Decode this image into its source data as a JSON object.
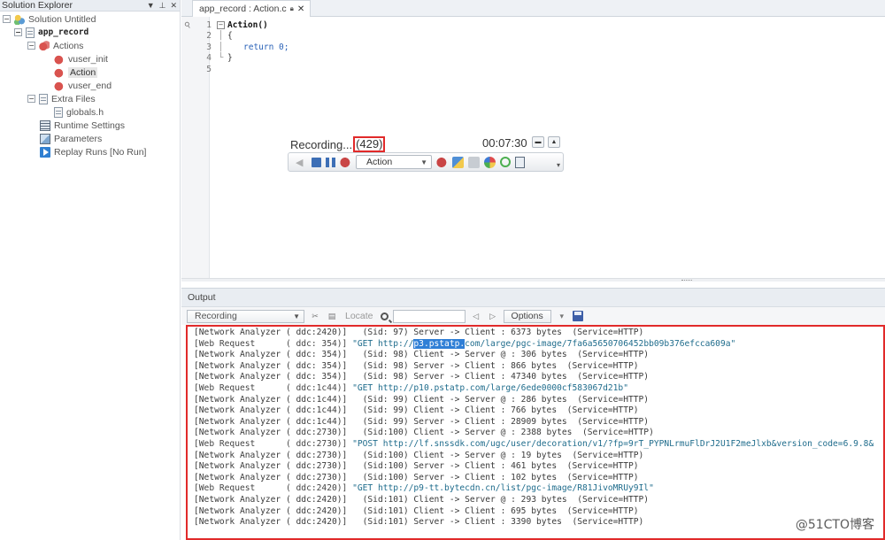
{
  "solution_explorer": {
    "title": "Solution Explorer",
    "icons": [
      "chevron-down-icon",
      "pin-icon",
      "close-icon"
    ],
    "items": [
      {
        "label": "Solution Untitled",
        "icon": "solution-icon"
      },
      {
        "label": "app_record",
        "icon": "script-icon"
      },
      {
        "label": "Actions",
        "icon": "actions-icon"
      },
      {
        "label": "vuser_init",
        "icon": "action-icon"
      },
      {
        "label": "Action",
        "icon": "action-icon"
      },
      {
        "label": "vuser_end",
        "icon": "action-icon"
      },
      {
        "label": "Extra Files",
        "icon": "folder-icon"
      },
      {
        "label": "globals.h",
        "icon": "file-icon"
      },
      {
        "label": "Runtime Settings",
        "icon": "settings-icon"
      },
      {
        "label": "Parameters",
        "icon": "parameters-icon"
      },
      {
        "label": "Replay Runs [No Run]",
        "icon": "replay-icon"
      }
    ]
  },
  "editor": {
    "tab_label": "app_record : Action.c",
    "code_lines": [
      {
        "num": "1",
        "text": "Action()"
      },
      {
        "num": "2",
        "text": "{"
      },
      {
        "num": "3",
        "text": "return 0;"
      },
      {
        "num": "4",
        "text": "}"
      },
      {
        "num": "5",
        "text": ""
      }
    ]
  },
  "recording_toolbar": {
    "label": "Recording...",
    "count": "(429)",
    "timer": "00:07:30",
    "action_select": "Action"
  },
  "output": {
    "title": "Output",
    "source_select": "Recording",
    "locate_label": "Locate",
    "options_label": "Options",
    "log_lines": [
      {
        "src": "[Network Analyzer",
        "ddc": "( ddc:2420)]",
        "msg": "(Sid: 97) Server -> Client : 6373 bytes  (Service=HTTP)"
      },
      {
        "src": "[Web Request     ",
        "ddc": "( ddc: 354)]",
        "msg_pre": "\"GET http://",
        "msg_hl": "p3.pstatp.",
        "msg_post": "com/large/pgc-image/7fa6a5650706452bb09b376efcca609a\""
      },
      {
        "src": "[Network Analyzer",
        "ddc": "( ddc: 354)]",
        "msg": "(Sid: 98) Client -> Server @ : 306 bytes  (Service=HTTP)"
      },
      {
        "src": "[Network Analyzer",
        "ddc": "( ddc: 354)]",
        "msg": "(Sid: 98) Server -> Client : 866 bytes  (Service=HTTP)"
      },
      {
        "src": "[Network Analyzer",
        "ddc": "( ddc: 354)]",
        "msg": "(Sid: 98) Server -> Client : 47340 bytes  (Service=HTTP)"
      },
      {
        "src": "[Web Request     ",
        "ddc": "( ddc:1c44)]",
        "msg_pre": "\"GET http://p10.pstatp.com/large/6ede0000cf583067d21b\""
      },
      {
        "src": "[Network Analyzer",
        "ddc": "( ddc:1c44)]",
        "msg": "(Sid: 99) Client -> Server @ : 286 bytes  (Service=HTTP)"
      },
      {
        "src": "[Network Analyzer",
        "ddc": "( ddc:1c44)]",
        "msg": "(Sid: 99) Client -> Client : 766 bytes  (Service=HTTP)"
      },
      {
        "src": "[Network Analyzer",
        "ddc": "( ddc:1c44)]",
        "msg": "(Sid: 99) Server -> Client : 28909 bytes  (Service=HTTP)"
      },
      {
        "src": "[Network Analyzer",
        "ddc": "( ddc:2730)]",
        "msg": "(Sid:100) Client -> Server @ : 2388 bytes  (Service=HTTP)"
      },
      {
        "src": "[Web Request     ",
        "ddc": "( ddc:2730)]",
        "msg_pre": "\"POST http://lf.snssdk.com/ugc/user/decoration/v1/?fp=9rT_PYPNLrmuFlDrJ2U1F2meJlxb&version_code=6.9.8&"
      },
      {
        "src": "[Network Analyzer",
        "ddc": "( ddc:2730)]",
        "msg": "(Sid:100) Client -> Server @ : 19 bytes  (Service=HTTP)"
      },
      {
        "src": "[Network Analyzer",
        "ddc": "( ddc:2730)]",
        "msg": "(Sid:100) Server -> Client : 461 bytes  (Service=HTTP)"
      },
      {
        "src": "[Network Analyzer",
        "ddc": "( ddc:2730)]",
        "msg": "(Sid:100) Server -> Client : 102 bytes  (Service=HTTP)"
      },
      {
        "src": "[Web Request     ",
        "ddc": "( ddc:2420)]",
        "msg_pre": "\"GET http://p9-tt.bytecdn.cn/list/pgc-image/R81JivoMRUy9Il\""
      },
      {
        "src": "[Network Analyzer",
        "ddc": "( ddc:2420)]",
        "msg": "(Sid:101) Client -> Server @ : 293 bytes  (Service=HTTP)"
      },
      {
        "src": "[Network Analyzer",
        "ddc": "( ddc:2420)]",
        "msg": "(Sid:101) Client -> Client : 695 bytes  (Service=HTTP)"
      },
      {
        "src": "[Network Analyzer",
        "ddc": "( ddc:2420)]",
        "msg": "(Sid:101) Server -> Client : 3390 bytes  (Service=HTTP)"
      }
    ]
  },
  "watermark": "@51CTO博客",
  "colors": {
    "highlight_border": "#e12a2a",
    "selection": "#2f7fd6",
    "panel_header": "#e9edf2"
  }
}
